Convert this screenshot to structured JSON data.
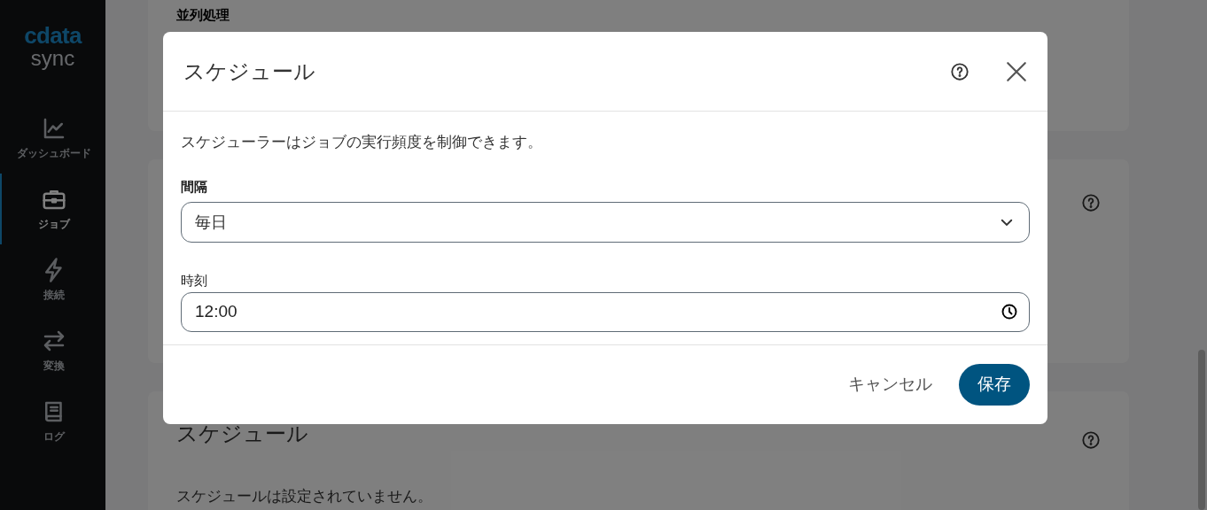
{
  "sidebar": {
    "logo": {
      "brand": "cdata",
      "product": "sync"
    },
    "items": [
      {
        "label": "ダッシュボード",
        "selected": false
      },
      {
        "label": "ジョブ",
        "selected": true
      },
      {
        "label": "接続",
        "selected": false
      },
      {
        "label": "変換",
        "selected": false
      },
      {
        "label": "ログ",
        "selected": false
      }
    ]
  },
  "page": {
    "sections": [
      {
        "kind": "plain",
        "title": "並列処理"
      },
      {
        "kind": "help"
      },
      {
        "kind": "help",
        "title": "スケジュール",
        "text": "スケジュールは設定されていません。"
      }
    ]
  },
  "dialog": {
    "title": "スケジュール",
    "description": "スケジューラーはジョブの実行頻度を制御できます。",
    "interval": {
      "label": "間隔",
      "value": "毎日"
    },
    "time": {
      "label": "時刻",
      "value": "12:00"
    },
    "buttons": [
      {
        "label": "キャンセル",
        "kind": "text"
      },
      {
        "label": "保存",
        "kind": "primary"
      }
    ]
  }
}
